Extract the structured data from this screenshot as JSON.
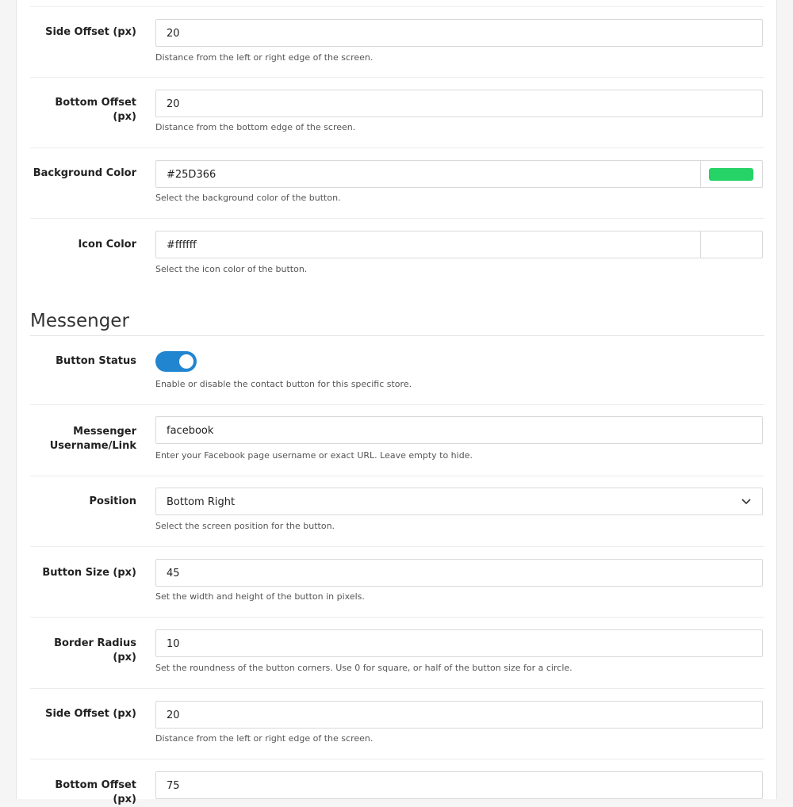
{
  "whatsapp": {
    "side_offset": {
      "label": "Side Offset (px)",
      "value": "20",
      "help": "Distance from the left or right edge of the screen."
    },
    "bottom_offset": {
      "label": "Bottom Offset (px)",
      "value": "20",
      "help": "Distance from the bottom edge of the screen."
    },
    "background_color": {
      "label": "Background Color",
      "value": "#25D366",
      "help": "Select the background color of the button.",
      "swatch": "#25D366"
    },
    "icon_color": {
      "label": "Icon Color",
      "value": "#ffffff",
      "help": "Select the icon color of the button.",
      "swatch": "#ffffff"
    }
  },
  "messenger": {
    "title": "Messenger",
    "button_status": {
      "label": "Button Status",
      "enabled": true,
      "help": "Enable or disable the contact button for this specific store."
    },
    "username": {
      "label_line1": "Messenger",
      "label_line2": "Username/Link",
      "value": "facebook",
      "help": "Enter your Facebook page username or exact URL. Leave empty to hide."
    },
    "position": {
      "label": "Position",
      "value": "Bottom Right",
      "help": "Select the screen position for the button."
    },
    "button_size": {
      "label": "Button Size (px)",
      "value": "45",
      "help": "Set the width and height of the button in pixels."
    },
    "border_radius": {
      "label": "Border Radius (px)",
      "value": "10",
      "help": "Set the roundness of the button corners. Use 0 for square, or half of the button size for a circle."
    },
    "side_offset": {
      "label": "Side Offset (px)",
      "value": "20",
      "help": "Distance from the left or right edge of the screen."
    },
    "bottom_offset": {
      "label": "Bottom Offset (px)",
      "value": "75"
    }
  },
  "colors": {
    "accent": "#2185d0"
  }
}
